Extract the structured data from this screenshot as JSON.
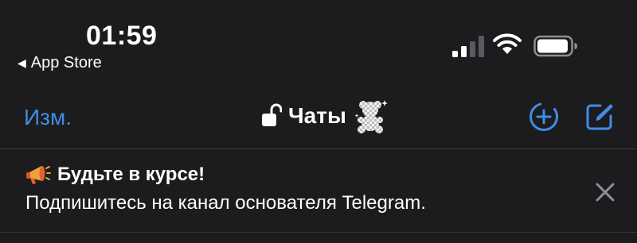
{
  "status_bar": {
    "time": "01:59",
    "back_app_label": "App Store",
    "icons": [
      "signal-icon",
      "wifi-icon",
      "battery-icon"
    ]
  },
  "nav": {
    "edit_label": "Изм.",
    "title": "Чаты",
    "icons": [
      "lock-open-icon",
      "bear-emoji-icon",
      "add-circle-icon",
      "compose-icon"
    ]
  },
  "banner": {
    "title": "Будьте в курсе!",
    "text": "Подпишитесь на канал основателя Telegram.",
    "icons": [
      "megaphone-icon",
      "close-icon"
    ]
  },
  "colors": {
    "background": "#1c1c1e",
    "accent": "#3e8ee6",
    "divider": "#38383a",
    "close_gray": "#8e8e93"
  }
}
